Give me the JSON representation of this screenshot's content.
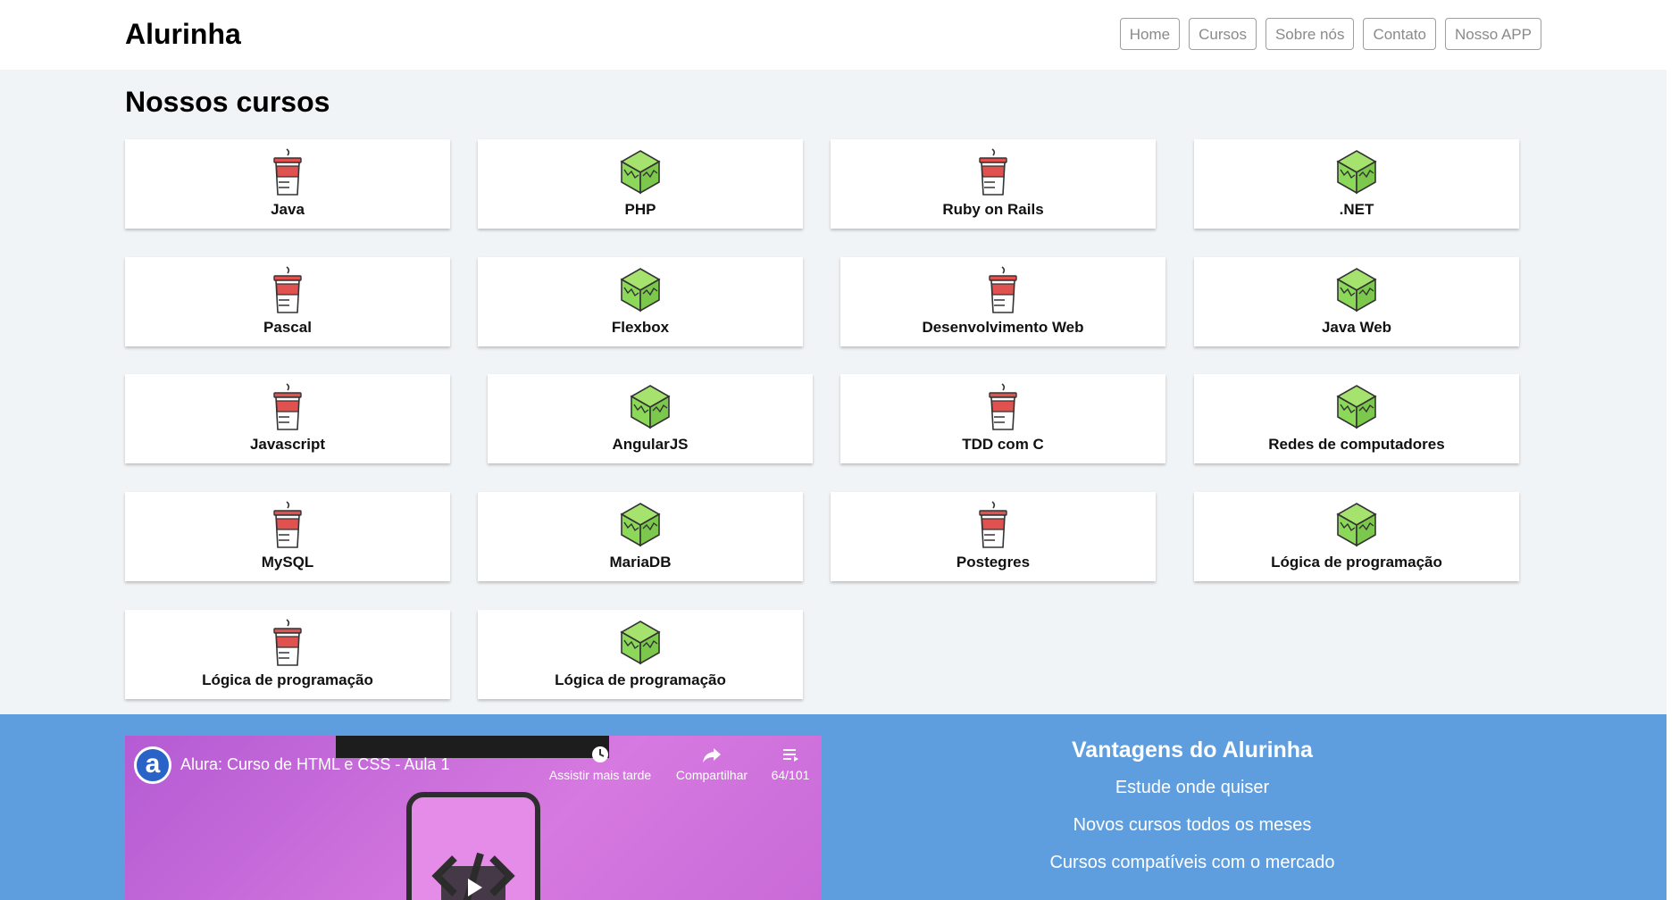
{
  "header": {
    "logo": "Alurinha",
    "nav": [
      "Home",
      "Cursos",
      "Sobre nós",
      "Contato",
      "Nosso APP"
    ]
  },
  "courses": {
    "title": "Nossos cursos",
    "items": [
      {
        "label": "Java",
        "icon": "cup-icon"
      },
      {
        "label": "PHP",
        "icon": "cube-icon"
      },
      {
        "label": "Ruby on Rails",
        "icon": "cup-icon"
      },
      {
        "label": ".NET",
        "icon": "cube-icon"
      },
      {
        "label": "Pascal",
        "icon": "cup-icon"
      },
      {
        "label": "Flexbox",
        "icon": "cube-icon"
      },
      {
        "label": "Desenvolvimento Web",
        "icon": "cup-icon"
      },
      {
        "label": "Java Web",
        "icon": "cube-icon"
      },
      {
        "label": "Javascript",
        "icon": "cup-icon"
      },
      {
        "label": "AngularJS",
        "icon": "cube-icon"
      },
      {
        "label": "TDD com C",
        "icon": "cup-icon"
      },
      {
        "label": "Redes de computadores",
        "icon": "cube-icon"
      },
      {
        "label": "MySQL",
        "icon": "cup-icon"
      },
      {
        "label": "MariaDB",
        "icon": "cube-icon"
      },
      {
        "label": "Postegres",
        "icon": "cup-icon"
      },
      {
        "label": "Lógica de programação",
        "icon": "cube-icon"
      },
      {
        "label": "Lógica de programação",
        "icon": "cup-icon"
      },
      {
        "label": "Lógica de programação",
        "icon": "cube-icon"
      }
    ]
  },
  "video": {
    "channel_initial": "a",
    "title": "Alura: Curso de HTML e CSS - Aula 1",
    "watch_later": "Assistir mais tarde",
    "share": "Compartilhar",
    "playlist": "64/101"
  },
  "advantages": {
    "title": "Vantagens do Alurinha",
    "items": [
      "Estude onde quiser",
      "Novos cursos todos os meses",
      "Cursos compatíveis com o mercado"
    ]
  },
  "colors": {
    "footer_bg": "#5f9ede",
    "page_bg": "#f1f4f6",
    "cup_red": "#e0524f",
    "cube_green": "#8cd95a"
  }
}
